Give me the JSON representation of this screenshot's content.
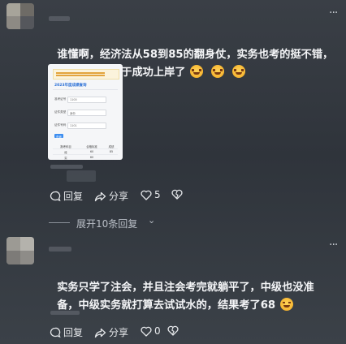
{
  "post1": {
    "text_line1": "谁懂啊，经济法从58到85的翻身仗，实务也考的挺不错，",
    "text_line2": "好高兴，我终于成功上岸了",
    "screenshot": {
      "title": "2023年度成绩查询",
      "fields": [
        {
          "label": "准考证号",
          "value": "1100"
        },
        {
          "label": "证件类型",
          "value": "身份"
        },
        {
          "label": "证件号码",
          "value": "1101"
        }
      ],
      "button_label": "查询",
      "table": [
        [
          "报考科目",
          "合格标准",
          "成绩"
        ],
        [
          "经",
          "60",
          "85"
        ],
        [
          "实",
          "60",
          ""
        ]
      ]
    },
    "actions": {
      "reply": "回复",
      "share": "分享",
      "like_count": "5"
    },
    "expand": "展开10条回复"
  },
  "post2": {
    "text_line1": "实务只学了注会，并且注会考完就躺平了，中级也没准",
    "text_line2": "备，中级实务就打算去试试水的，结果考了68",
    "actions": {
      "reply": "回复",
      "share": "分享",
      "like_count": "0"
    }
  },
  "icons": [
    "more-icon",
    "reply-icon",
    "share-icon",
    "heart-icon",
    "dislike-icon",
    "chevron-down-icon"
  ]
}
